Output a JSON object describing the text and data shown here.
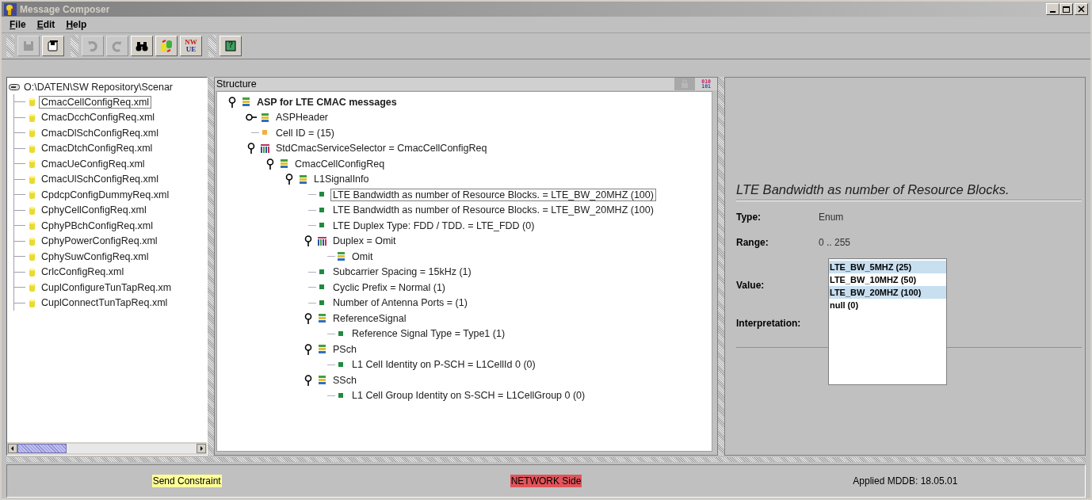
{
  "window": {
    "title": "Message Composer"
  },
  "menu": [
    "File",
    "Edit",
    "Help"
  ],
  "toolbar": [
    [
      {
        "kind": "save",
        "disabled": true
      },
      {
        "kind": "save-as",
        "disabled": false
      }
    ],
    [
      {
        "kind": "undo",
        "disabled": true
      },
      {
        "kind": "redo",
        "disabled": true
      },
      {
        "kind": "find",
        "disabled": false
      },
      {
        "kind": "convert",
        "disabled": false
      },
      {
        "kind": "nwue",
        "lines": [
          "NW",
          "UE"
        ],
        "disabled": false
      }
    ],
    [
      {
        "kind": "help",
        "glyph": "?",
        "disabled": false
      }
    ]
  ],
  "file_tree": {
    "root": "O:\\DATEN\\SW Repository\\Scenar",
    "items": [
      {
        "label": "CmacCellConfigReq.xml",
        "selected": true
      },
      {
        "label": "CmacDcchConfigReq.xml",
        "selected": false
      },
      {
        "label": "CmacDlSchConfigReq.xml",
        "selected": false
      },
      {
        "label": "CmacDtchConfigReq.xml",
        "selected": false
      },
      {
        "label": "CmacUeConfigReq.xml",
        "selected": false
      },
      {
        "label": "CmacUlSchConfigReq.xml",
        "selected": false
      },
      {
        "label": "CpdcpConfigDummyReq.xml",
        "selected": false
      },
      {
        "label": "CphyCellConfigReq.xml",
        "selected": false
      },
      {
        "label": "CphyPBchConfigReq.xml",
        "selected": false
      },
      {
        "label": "CphyPowerConfigReq.xml",
        "selected": false
      },
      {
        "label": "CphySuwConfigReq.xml",
        "selected": false
      },
      {
        "label": "CrlcConfigReq.xml",
        "selected": false
      },
      {
        "label": "CuplConfigureTunTapReq.xm",
        "selected": false
      },
      {
        "label": "CuplConnectTunTapReq.xml",
        "selected": false
      }
    ]
  },
  "structure": {
    "title": "Structure",
    "binary_lines": [
      "010",
      "101"
    ],
    "tree": [
      {
        "label": "ASP for LTE CMAC messages",
        "kind": "struct",
        "expanded": true,
        "selected": false,
        "children": [
          {
            "label": "ASPHeader",
            "kind": "struct",
            "expanded": false,
            "selected": false
          },
          {
            "label": "Cell ID = (15)",
            "kind": "header-field",
            "selected": false
          },
          {
            "label": "StdCmacServiceSelector = CmacCellConfigReq",
            "kind": "union",
            "expanded": true,
            "selected": false,
            "children": [
              {
                "label": "CmacCellConfigReq",
                "kind": "struct",
                "expanded": true,
                "selected": false,
                "children": [
                  {
                    "label": "L1SignalInfo",
                    "kind": "struct",
                    "expanded": true,
                    "selected": false,
                    "children": [
                      {
                        "label": "LTE Bandwidth as number of Resource Blocks. = LTE_BW_20MHZ (100)",
                        "kind": "field",
                        "selected": true
                      },
                      {
                        "label": "LTE Bandwidth as number of Resource Blocks. = LTE_BW_20MHZ (100)",
                        "kind": "field",
                        "selected": false
                      },
                      {
                        "label": "LTE Duplex Type: FDD / TDD. = LTE_FDD (0)",
                        "kind": "field",
                        "selected": false
                      },
                      {
                        "label": "Duplex = Omit",
                        "kind": "union",
                        "expanded": true,
                        "selected": false,
                        "children": [
                          {
                            "label": "Omit",
                            "kind": "struct",
                            "selected": false
                          }
                        ]
                      },
                      {
                        "label": "Subcarrier Spacing = 15kHz (1)",
                        "kind": "field",
                        "selected": false
                      },
                      {
                        "label": "Cyclic Prefix = Normal (1)",
                        "kind": "field",
                        "selected": false
                      },
                      {
                        "label": "Number of Antenna Ports = (1)",
                        "kind": "field",
                        "selected": false
                      },
                      {
                        "label": "ReferenceSignal",
                        "kind": "struct",
                        "expanded": true,
                        "selected": false,
                        "children": [
                          {
                            "label": "Reference Signal Type = Type1 (1)",
                            "kind": "field",
                            "selected": false
                          }
                        ]
                      },
                      {
                        "label": "PSch",
                        "kind": "struct",
                        "expanded": true,
                        "selected": false,
                        "children": [
                          {
                            "label": "L1 Cell Identity on P-SCH = L1CellId 0 (0)",
                            "kind": "field",
                            "selected": false
                          }
                        ]
                      },
                      {
                        "label": "SSch",
                        "kind": "struct",
                        "expanded": true,
                        "selected": false,
                        "children": [
                          {
                            "label": "L1 Cell Group Identity on S-SCH = L1CellGroup   0 (0)",
                            "kind": "field",
                            "selected": false
                          }
                        ]
                      }
                    ]
                  }
                ]
              }
            ]
          }
        ]
      }
    ]
  },
  "details": {
    "heading": "LTE Bandwidth as number of Resource Blocks.",
    "fields": [
      {
        "kind": "text",
        "label": "Type:",
        "value": "Enum"
      },
      {
        "kind": "text",
        "label": "Range:",
        "value": "0 .. 255"
      },
      {
        "kind": "list",
        "label": "Value:",
        "options": [
          {
            "label": "LTE_BW_5MHZ (25)",
            "selected": true
          },
          {
            "label": "LTE_BW_10MHZ (50)",
            "selected": false
          },
          {
            "label": "LTE_BW_20MHZ (100)",
            "selected": true
          },
          {
            "label": "null (0)",
            "selected": false
          }
        ]
      },
      {
        "kind": "empty",
        "label": "Interpretation:"
      }
    ]
  },
  "status_bar": [
    {
      "text": "Send Constraint",
      "color": "#ffff99"
    },
    {
      "text": "NETWORK Side",
      "color": "#e0545a"
    },
    {
      "text": "Applied MDDB: 18.05.01"
    }
  ]
}
